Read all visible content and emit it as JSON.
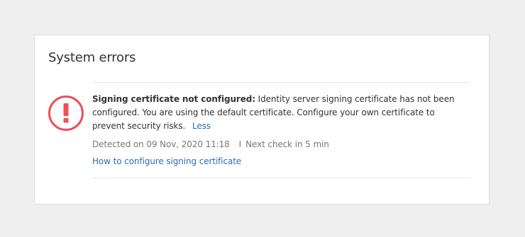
{
  "panel": {
    "title": "System errors"
  },
  "error": {
    "icon": "exclamation-circle-icon",
    "title": "Signing certificate not configured:",
    "message": "Identity server signing certificate has not been configured. You are using the default certificate. Configure your own certificate to prevent security risks.",
    "toggle_label": "Less",
    "detected": "Detected on 09 Nov, 2020 11:18",
    "separator": "I",
    "next_check": "Next check in 5 min",
    "help_link": "How to configure signing certificate"
  },
  "colors": {
    "error": "#ef4f57",
    "link": "#2a6ebb",
    "background": "#efefef"
  }
}
